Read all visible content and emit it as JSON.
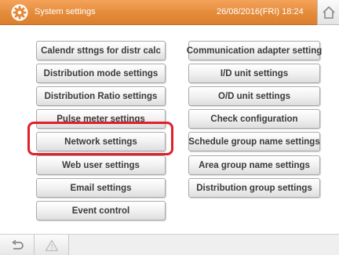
{
  "header": {
    "title": "System settings",
    "datetime": "26/08/2016(FRI) 18:24",
    "icon": "gear-icon",
    "home_icon": "home-icon",
    "color": "#e48b3a"
  },
  "buttons_left": [
    "Calendr sttngs for distr calc",
    "Distribution mode settings",
    "Distribution Ratio settings",
    "Pulse meter settings",
    "Network settings",
    "Web user settings",
    "Email settings",
    "Event control"
  ],
  "buttons_right": [
    "Communication adapter setting",
    "I/D unit settings",
    "O/D unit settings",
    "Check configuration",
    "Schedule group name settings",
    "Area group name settings",
    "Distribution group settings"
  ],
  "highlight": {
    "target": "Network settings",
    "color": "#e0202c"
  },
  "footer": {
    "back_icon": "back-arrow-icon",
    "warning_icon": "warning-icon"
  }
}
